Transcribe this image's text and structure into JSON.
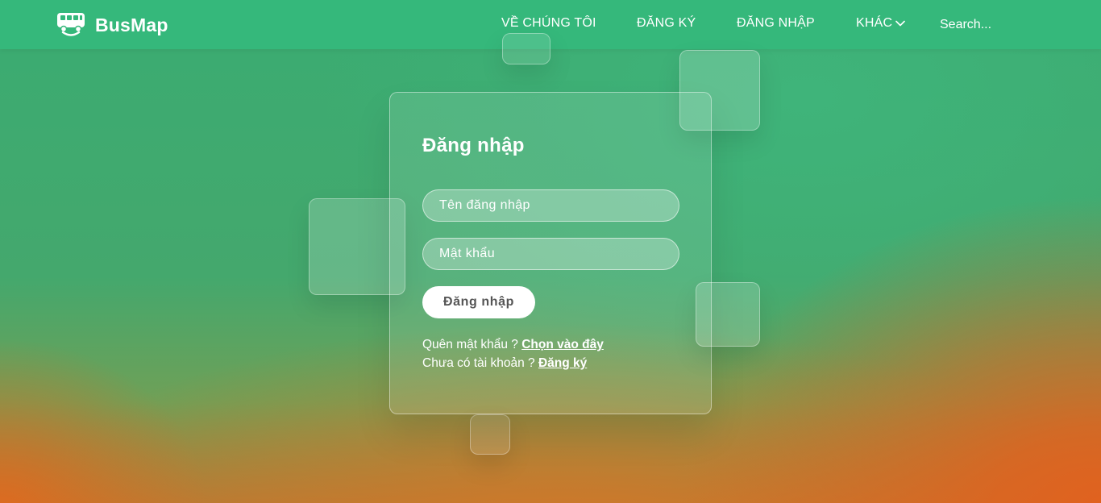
{
  "nav": {
    "logo_text": "BusMap",
    "logo_icon": "bus-icon",
    "items": [
      {
        "label": "VỀ CHÚNG TÔI"
      },
      {
        "label": "ĐĂNG KÝ"
      },
      {
        "label": "ĐĂNG NHẬP"
      },
      {
        "label": "KHÁC",
        "icon": "chevron-down-icon"
      }
    ],
    "search_placeholder": "Search..."
  },
  "login": {
    "title": "Đăng nhập",
    "username_placeholder": "Tên đăng nhập",
    "password_placeholder": "Mật khẩu",
    "submit_label": "Đăng nhập",
    "forgot_text": "Quên mật khẩu ? ",
    "forgot_link": "Chọn vào đây",
    "register_text": "Chưa có tài khoản ? ",
    "register_link": "Đăng ký"
  },
  "colors": {
    "navbar": "#35b87b",
    "background_top": "#3aac72",
    "background_corner": "#e0621f",
    "button_bg": "#ffffff"
  }
}
